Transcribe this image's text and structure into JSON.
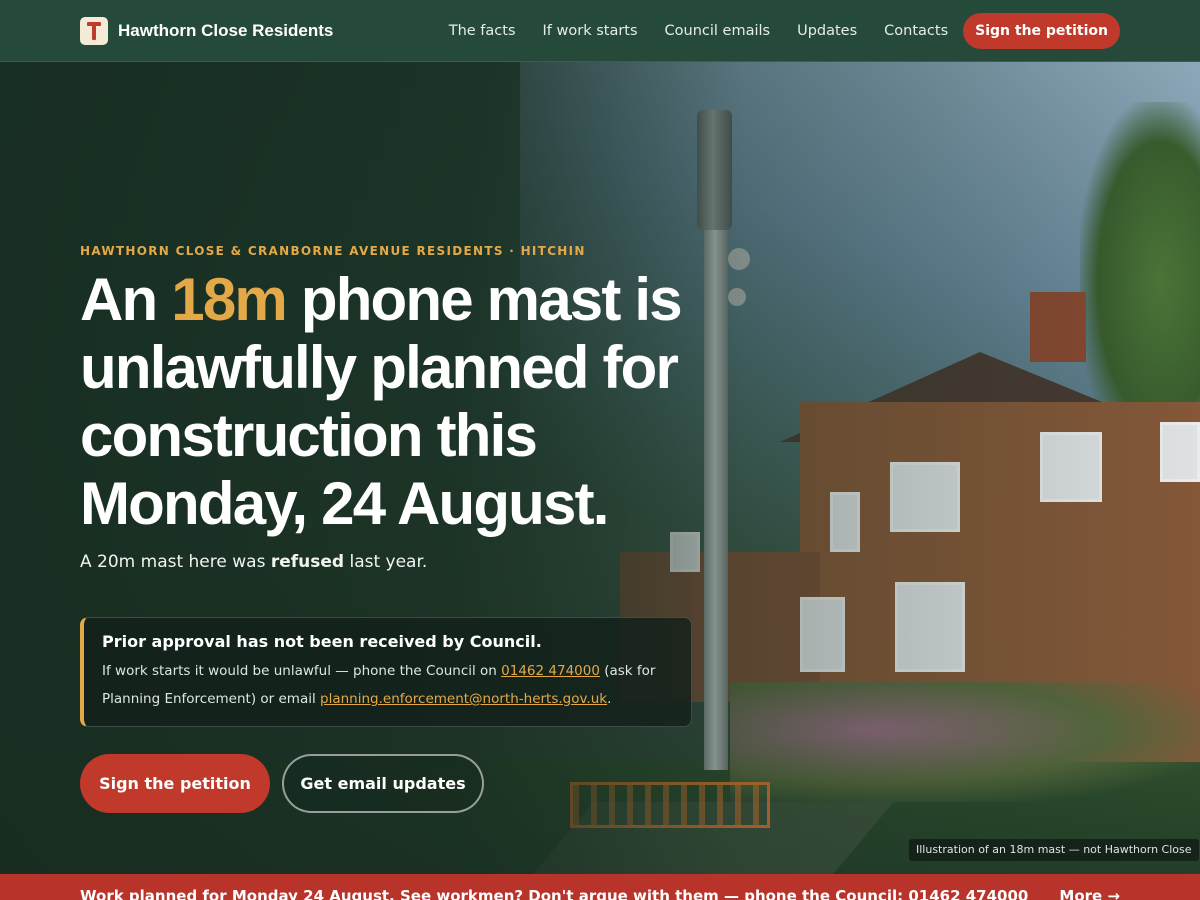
{
  "header": {
    "brand_name": "Hawthorn Close Residents",
    "nav": [
      "The facts",
      "If work starts",
      "Council emails",
      "Updates",
      "Contacts"
    ],
    "cta_label": "Sign the petition"
  },
  "hero": {
    "eyebrow": "HAWTHORN CLOSE & CRANBORNE AVENUE RESIDENTS · HITCHIN",
    "headline_pre": "An ",
    "headline_accent": "18m",
    "headline_post": " phone mast is unlawfully planned for construction this Monday, 24 August.",
    "sub_pre": "A 20m mast here was ",
    "sub_bold": "refused",
    "sub_post": " last year.",
    "notice": {
      "title": "Prior approval has not been received by Council.",
      "body_pre": "If work starts it would be unlawful — phone the Council on ",
      "phone": "01462 474000",
      "body_mid": " (ask for Planning Enforcement) or email ",
      "email": "planning.enforcement@north-herts.gov.uk",
      "body_post": "."
    },
    "primary_button": "Sign the petition",
    "secondary_button": "Get email updates",
    "image_caption": "Illustration of an 18m mast — not Hawthorn Close"
  },
  "alert": {
    "text": "Work planned for Monday 24 August. See workmen? Don't argue with them — phone the Council: 01462 474000",
    "more": "More →"
  },
  "colors": {
    "accent": "#e3a948",
    "brand_red": "#c0392b",
    "header_green": "#264a39"
  },
  "icons": {
    "logo": "mast-logo-icon"
  }
}
